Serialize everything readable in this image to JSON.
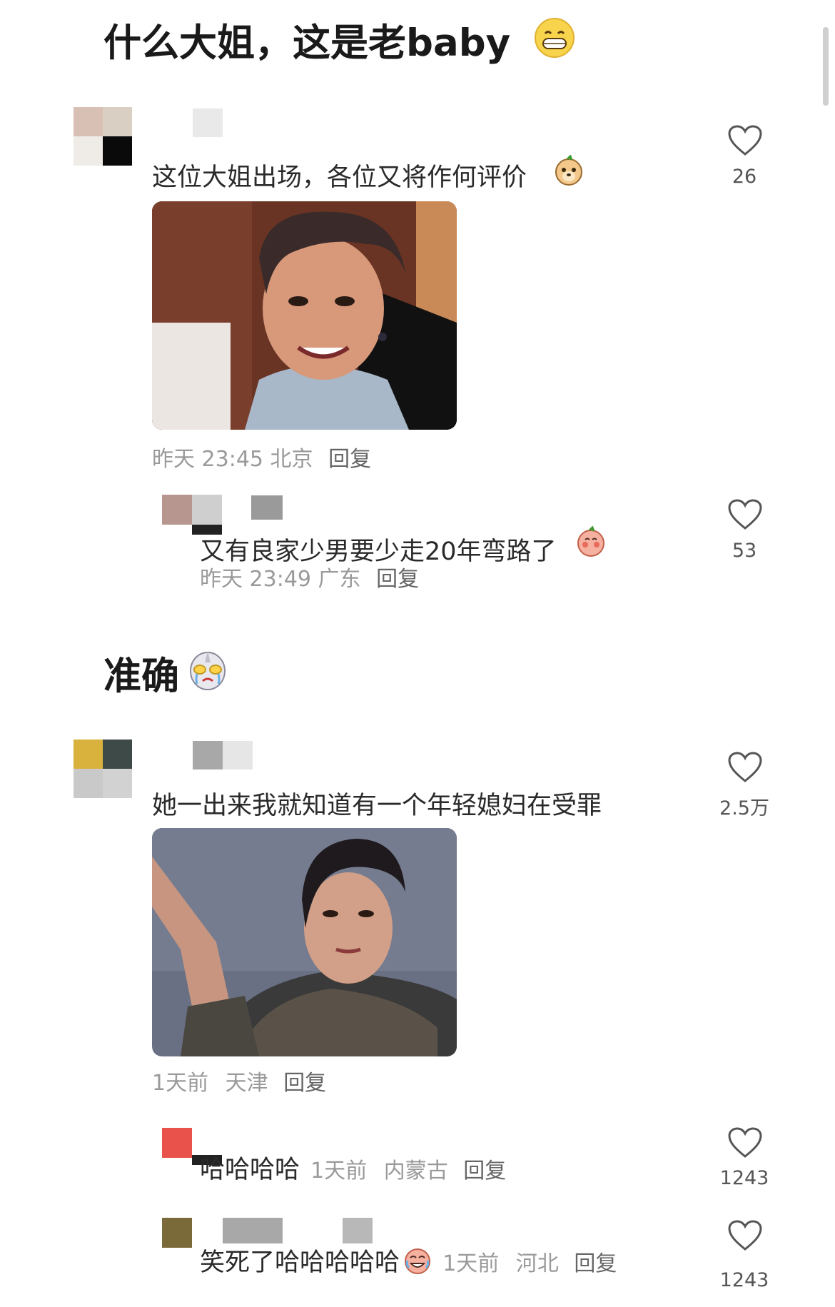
{
  "post": {
    "heading1": "什么大姐，这是老baby",
    "heading2": "准确"
  },
  "comments": [
    {
      "text": "这位大姐出场，各位又将作何评价",
      "time": "昨天 23:45",
      "location": "北京",
      "reply_label": "回复",
      "likes": "26",
      "image_description": "photo"
    },
    {
      "text": "又有良家少男要少走20年弯路了",
      "time": "昨天 23:49",
      "location": "广东",
      "reply_label": "回复",
      "likes": "53"
    },
    {
      "text": "她一出来我就知道有一个年轻媳妇在受罪",
      "time": "1天前",
      "location": "天津",
      "reply_label": "回复",
      "likes": "2.5万"
    },
    {
      "text": "哈哈哈哈",
      "time": "1天前",
      "location": "内蒙古",
      "reply_label": "回复",
      "likes": "1243"
    },
    {
      "text": "笑死了哈哈哈哈哈",
      "time": "1天前",
      "location": "河北",
      "reply_label": "回复",
      "likes": "1243"
    }
  ],
  "icons": {
    "like": "heart-outline-icon",
    "emoji_grin": "grinning-face-icon",
    "emoji_dog": "dog-face-icon",
    "emoji_shy": "shy-peach-icon",
    "emoji_ultraman": "ultraman-crying-icon",
    "emoji_laugh_cry": "laugh-crying-icon"
  },
  "colors": {
    "text": "#2a2a2a",
    "meta": "#9a9a9a",
    "heart_stroke": "#555555"
  }
}
